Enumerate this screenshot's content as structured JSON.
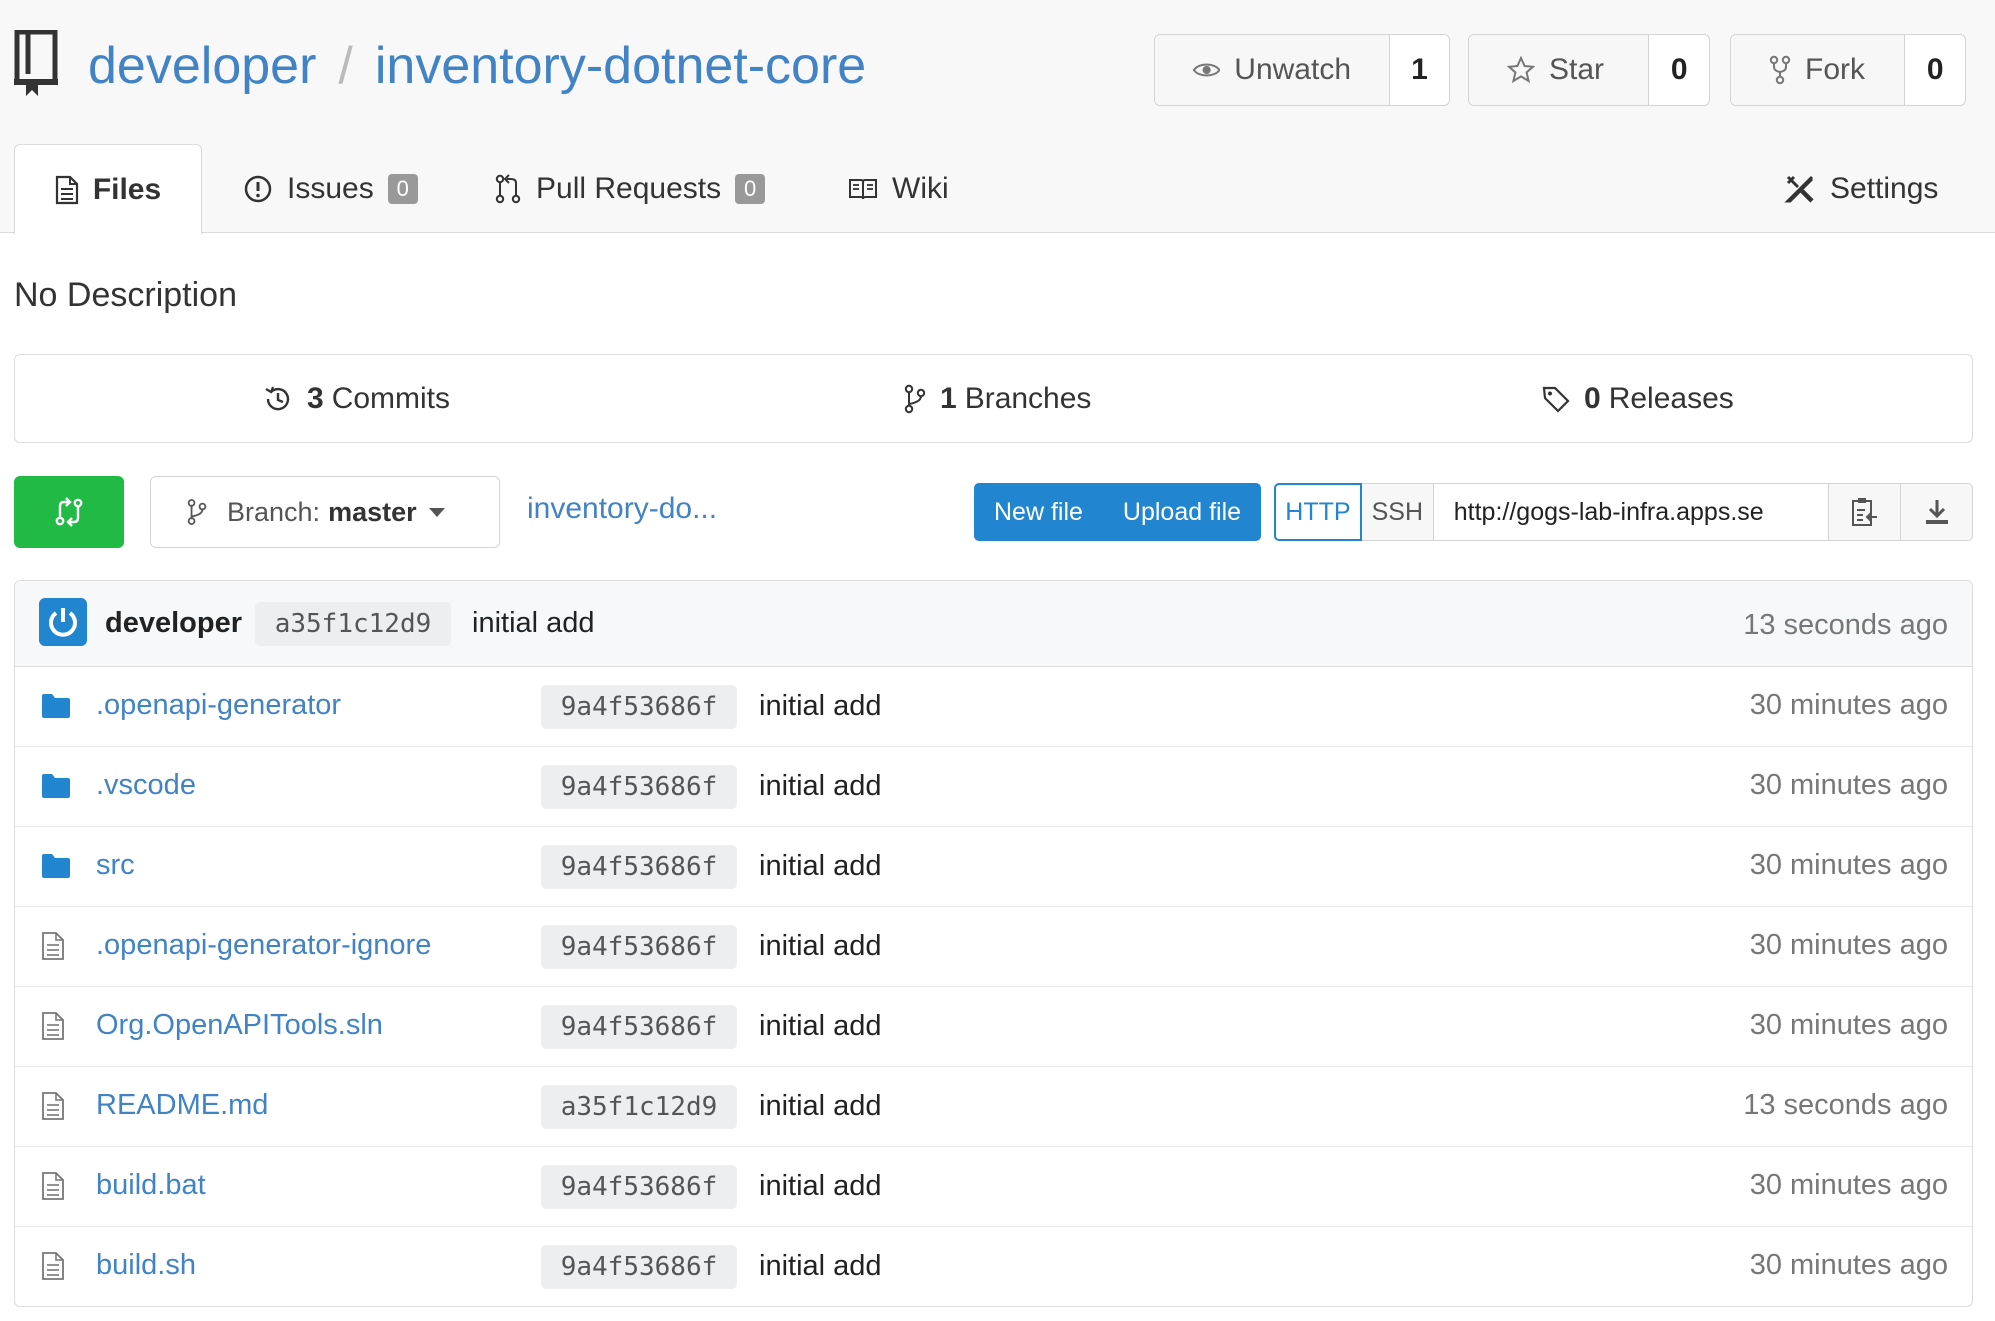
{
  "repo": {
    "owner": "developer",
    "separator": "/",
    "name": "inventory-dotnet-core"
  },
  "actions": {
    "watch": {
      "label": "Unwatch",
      "count": "1"
    },
    "star": {
      "label": "Star",
      "count": "0"
    },
    "fork": {
      "label": "Fork",
      "count": "0"
    }
  },
  "tabs": {
    "files": "Files",
    "issues": {
      "label": "Issues",
      "count": "0"
    },
    "pulls": {
      "label": "Pull Requests",
      "count": "0"
    },
    "wiki": "Wiki",
    "settings": "Settings"
  },
  "description": "No Description",
  "stats": {
    "commits": {
      "count": "3",
      "label": "Commits"
    },
    "branches": {
      "count": "1",
      "label": "Branches"
    },
    "releases": {
      "count": "0",
      "label": "Releases"
    }
  },
  "toolbar": {
    "branch_prefix": "Branch:",
    "branch_name": "master",
    "path": "inventory-do...",
    "new_file": "New file",
    "upload_file": "Upload file",
    "http": "HTTP",
    "ssh": "SSH",
    "clone_url": "http://gogs-lab-infra.apps.se"
  },
  "latest_commit": {
    "author": "developer",
    "sha": "a35f1c12d9",
    "message": "initial add",
    "age": "13 seconds ago"
  },
  "files": [
    {
      "type": "folder",
      "name": ".openapi-generator",
      "sha": "9a4f53686f",
      "message": "initial add",
      "age": "30 minutes ago"
    },
    {
      "type": "folder",
      "name": ".vscode",
      "sha": "9a4f53686f",
      "message": "initial add",
      "age": "30 minutes ago"
    },
    {
      "type": "folder",
      "name": "src",
      "sha": "9a4f53686f",
      "message": "initial add",
      "age": "30 minutes ago"
    },
    {
      "type": "file",
      "name": ".openapi-generator-ignore",
      "sha": "9a4f53686f",
      "message": "initial add",
      "age": "30 minutes ago"
    },
    {
      "type": "file",
      "name": "Org.OpenAPITools.sln",
      "sha": "9a4f53686f",
      "message": "initial add",
      "age": "30 minutes ago"
    },
    {
      "type": "file",
      "name": "README.md",
      "sha": "a35f1c12d9",
      "message": "initial add",
      "age": "13 seconds ago"
    },
    {
      "type": "file",
      "name": "build.bat",
      "sha": "9a4f53686f",
      "message": "initial add",
      "age": "30 minutes ago"
    },
    {
      "type": "file",
      "name": "build.sh",
      "sha": "9a4f53686f",
      "message": "initial add",
      "age": "30 minutes ago"
    }
  ],
  "colors": {
    "link": "#4183c4",
    "primary": "#2185d0",
    "success": "#21ba45"
  }
}
